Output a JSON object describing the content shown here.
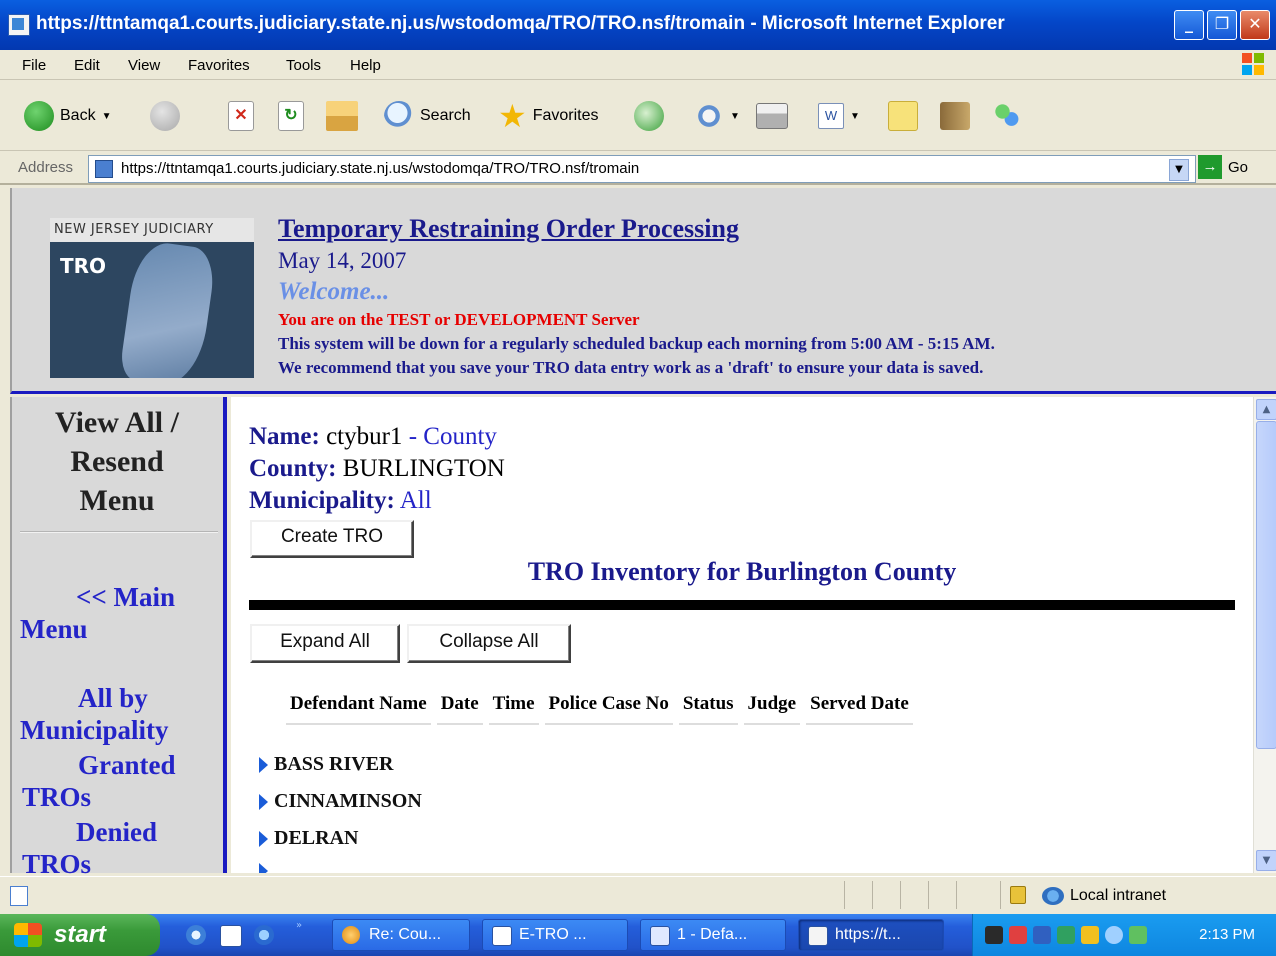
{
  "window": {
    "title": "https://ttntamqa1.courts.judiciary.state.nj.us/wstodomqa/TRO/TRO.nsf/tromain - Microsoft Internet Explorer",
    "minimize": "_",
    "restore": "❐",
    "close": "✕"
  },
  "menubar": {
    "items": [
      "File",
      "Edit",
      "View",
      "Favorites",
      "Tools",
      "Help"
    ]
  },
  "toolbar": {
    "back": "Back",
    "search": "Search",
    "favorites": "Favorites"
  },
  "address": {
    "label": "Address",
    "url": "https://ttntamqa1.courts.judiciary.state.nj.us/wstodomqa/TRO/TRO.nsf/tromain",
    "go": "Go"
  },
  "header": {
    "logo_band": "NEW JERSEY JUDICIARY",
    "logo_tro": "TRO",
    "title": "Temporary Restraining Order Processing",
    "date": "May 14, 2007",
    "welcome": "Welcome...",
    "server_warning": "You are on the TEST or DEVELOPMENT Server",
    "notes": [
      "This system will be down for a regularly scheduled backup each morning from 5:00 AM - 5:15 AM.",
      "We recommend that you save your TRO data entry work as a 'draft' to ensure your data is saved."
    ]
  },
  "sidebar": {
    "heading_lines": [
      "View All /",
      "Resend",
      "Menu"
    ],
    "links": [
      {
        "line1": "<< Main",
        "line2": "Menu"
      },
      {
        "line1": "All by",
        "line2": "Municipality"
      },
      {
        "line1": "Granted",
        "line2": "TROs"
      },
      {
        "line1": "Denied",
        "line2": "TROs"
      }
    ]
  },
  "main": {
    "name_label": "Name:",
    "name_value": "ctybur1",
    "name_suffix": "- County",
    "county_label": "County:",
    "county_value": "BURLINGTON",
    "municipality_label": "Municipality:",
    "municipality_value": "All",
    "create_button": "Create TRO",
    "inventory_title": "TRO Inventory for Burlington County",
    "expand_all": "Expand All",
    "collapse_all": "Collapse All",
    "columns": [
      "Defendant Name",
      "Date",
      "Time",
      "Police Case No",
      "Status",
      "Judge",
      "Served Date"
    ],
    "municipalities": [
      "BASS RIVER",
      "CINNAMINSON",
      "DELRAN"
    ]
  },
  "statusbar": {
    "zone": "Local intranet"
  },
  "taskbar": {
    "start": "start",
    "tasks": [
      "Re: Cou...",
      "E-TRO ...",
      "1 - Defa...",
      "https://t..."
    ],
    "clock": "2:13 PM"
  }
}
